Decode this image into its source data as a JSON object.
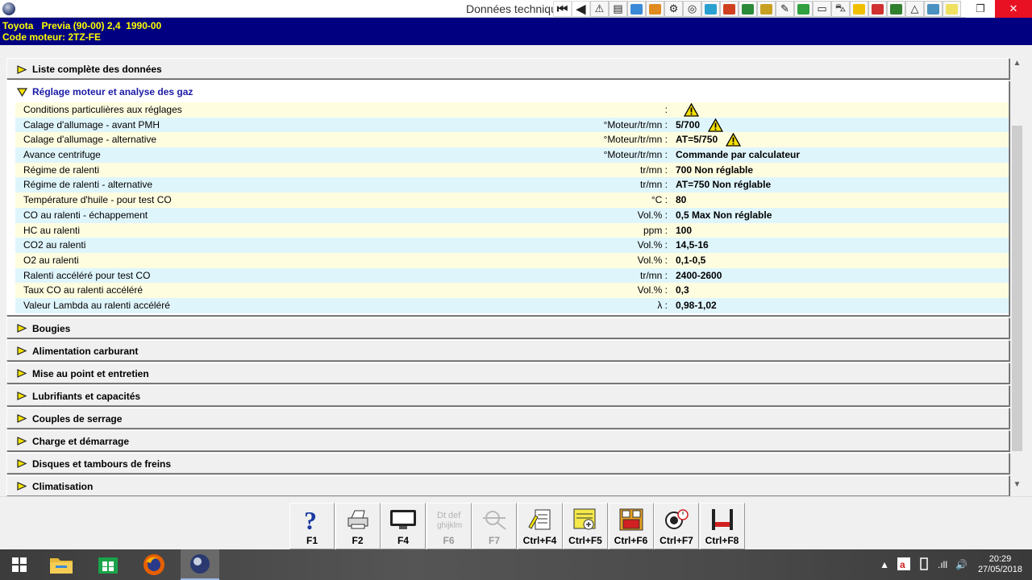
{
  "window": {
    "title": "Données techniques",
    "restore_glyph": "❐",
    "close_glyph": "✕"
  },
  "toolbar": {
    "buttons": [
      {
        "icon": "first-page-icon",
        "glyph": "⏮"
      },
      {
        "icon": "previous-page-icon",
        "glyph": "◀"
      },
      {
        "icon": "warning-icon",
        "glyph": "⚠"
      },
      {
        "icon": "document-icon",
        "glyph": "▤"
      },
      {
        "icon": "diagram-icon",
        "glyph": "",
        "color": "#3a8ad8"
      },
      {
        "icon": "engine-icon",
        "glyph": "",
        "color": "#e08a20"
      },
      {
        "icon": "timing-icon",
        "glyph": "⚙"
      },
      {
        "icon": "wheel-icon",
        "glyph": "◎"
      },
      {
        "icon": "service-icon",
        "glyph": "",
        "color": "#2aa0d0"
      },
      {
        "icon": "electrical-icon",
        "glyph": "",
        "color": "#d04020"
      },
      {
        "icon": "vehicle-lift-icon",
        "glyph": "",
        "color": "#2a8a3a"
      },
      {
        "icon": "mechanic-icon",
        "glyph": "",
        "color": "#c8a020"
      },
      {
        "icon": "tools-icon",
        "glyph": "✎"
      },
      {
        "icon": "fluids-icon",
        "glyph": "",
        "color": "#30a040"
      },
      {
        "icon": "keyboard-icon",
        "glyph": "▭"
      },
      {
        "icon": "car-icon",
        "glyph": "⛍"
      },
      {
        "icon": "emoji-icon",
        "glyph": "",
        "color": "#f0c000"
      },
      {
        "icon": "fuse-box-icon",
        "glyph": "",
        "color": "#d03030"
      },
      {
        "icon": "settings-icon",
        "glyph": "",
        "color": "#308030"
      },
      {
        "icon": "alert-triangle-icon",
        "glyph": "△"
      },
      {
        "icon": "glasses-icon",
        "glyph": "",
        "color": "#4a90c0"
      },
      {
        "icon": "notepad-icon",
        "glyph": "",
        "color": "#f0e060"
      }
    ]
  },
  "vehicle": {
    "line1": "Toyota   Previa (90-00) 2,4  1990-00",
    "line2": "Code moteur: 2TZ-FE"
  },
  "sections": [
    {
      "label": "Liste complète des données",
      "open": false
    },
    {
      "label": "Réglage moteur et analyse des gaz",
      "open": true
    },
    {
      "label": "Bougies",
      "open": false
    },
    {
      "label": "Alimentation carburant",
      "open": false
    },
    {
      "label": "Mise au point et entretien",
      "open": false
    },
    {
      "label": "Lubrifiants et capacités",
      "open": false
    },
    {
      "label": "Couples de serrage",
      "open": false
    },
    {
      "label": "Charge et démarrage",
      "open": false
    },
    {
      "label": "Disques et tambours de freins",
      "open": false
    },
    {
      "label": "Climatisation",
      "open": false
    }
  ],
  "rows": [
    {
      "label": "Conditions particulières aux réglages",
      "unit": ":",
      "value": "",
      "warn": true
    },
    {
      "label": "Calage d'allumage - avant PMH",
      "unit": "°Moteur/tr/mn :",
      "value": "5/700",
      "warn": true
    },
    {
      "label": "Calage d'allumage - alternative",
      "unit": "°Moteur/tr/mn :",
      "value": "AT=5/750",
      "warn": true
    },
    {
      "label": "Avance centrifuge",
      "unit": "°Moteur/tr/mn :",
      "value": "Commande par calculateur",
      "warn": false
    },
    {
      "label": "Régime de ralenti",
      "unit": "tr/mn :",
      "value": "700 Non réglable",
      "warn": false
    },
    {
      "label": "Régime de ralenti - alternative",
      "unit": "tr/mn :",
      "value": "AT=750 Non réglable",
      "warn": false
    },
    {
      "label": "Température d'huile - pour test CO",
      "unit": "°C :",
      "value": "80",
      "warn": false
    },
    {
      "label": "CO au ralenti - échappement",
      "unit": "Vol.% :",
      "value": "0,5 Max Non réglable",
      "warn": false
    },
    {
      "label": "HC au ralenti",
      "unit": "ppm :",
      "value": "100",
      "warn": false
    },
    {
      "label": "CO2 au ralenti",
      "unit": "Vol.% :",
      "value": "14,5-16",
      "warn": false
    },
    {
      "label": "O2 au ralenti",
      "unit": "Vol.% :",
      "value": "0,1-0,5",
      "warn": false
    },
    {
      "label": "Ralenti accéléré pour test CO",
      "unit": "tr/mn :",
      "value": "2400-2600",
      "warn": false
    },
    {
      "label": "Taux CO au ralenti accéléré",
      "unit": "Vol.% :",
      "value": "0,3",
      "warn": false
    },
    {
      "label": "Valeur Lambda au ralenti accéléré",
      "unit": "λ :",
      "value": "0,98-1,02",
      "warn": false
    }
  ],
  "scrollbar": {
    "up_glyph": "▲",
    "down_glyph": "▼"
  },
  "fkeys": [
    {
      "label": "F1",
      "icon": "help-icon",
      "enabled": true
    },
    {
      "label": "F2",
      "icon": "printer-icon",
      "enabled": true
    },
    {
      "label": "F4",
      "icon": "monitor-icon",
      "enabled": true
    },
    {
      "label": "F6",
      "icon": "text-icon",
      "enabled": false
    },
    {
      "label": "F7",
      "icon": "crosshair-icon",
      "enabled": false
    },
    {
      "label": "Ctrl+F4",
      "icon": "notes-icon",
      "enabled": true
    },
    {
      "label": "Ctrl+F5",
      "icon": "add-document-icon",
      "enabled": true
    },
    {
      "label": "Ctrl+F6",
      "icon": "fuse-icon",
      "enabled": true
    },
    {
      "label": "Ctrl+F7",
      "icon": "tools-clock-icon",
      "enabled": true
    },
    {
      "label": "Ctrl+F8",
      "icon": "lift-icon",
      "enabled": true
    }
  ],
  "fkey_icon_text": {
    "f6": "Dt def ghijklm",
    "ctrl_f6": "2 3"
  },
  "taskbar": {
    "apps": [
      "windows-start-icon",
      "file-explorer-icon",
      "store-icon",
      "firefox-icon",
      "autodata-icon"
    ],
    "tray": {
      "chevron": "▲",
      "network": ".ıll",
      "volume": "🔊",
      "time": "20:29",
      "date": "27/05/2018"
    }
  },
  "colors": {
    "header_bg": "#000080",
    "header_text": "#ffff00",
    "row_odd": "#fffde0",
    "row_even": "#dff5fc",
    "open_section_text": "#1a1aa6"
  }
}
